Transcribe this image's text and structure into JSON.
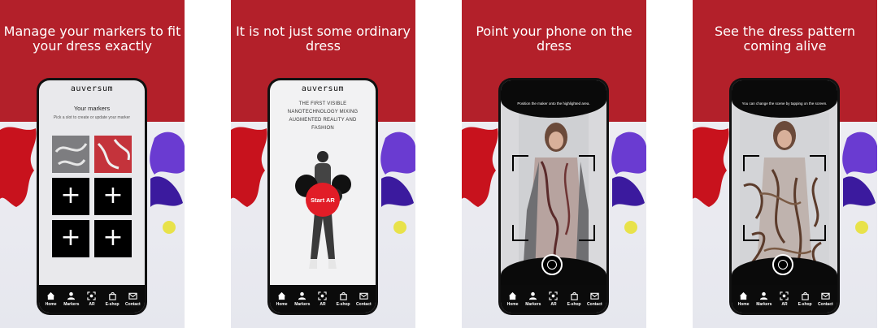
{
  "panels": [
    {
      "caption": "It is not just some ordinary dress"
    },
    {
      "caption": "Point your phone on the dress"
    },
    {
      "caption": "See the dress pattern coming alive"
    },
    {
      "caption": "Manage your markers to fit your dress exactly"
    }
  ],
  "home_screen": {
    "logo": "auversum",
    "tagline": "THE FIRST VISIBLE NANOTECHNOLOGY MIXING AUGMENTED REALITY AND FASHION",
    "start_button": "Start AR"
  },
  "ar_screen_1": {
    "instruction": "Position the maker onto the highlighted area."
  },
  "ar_screen_2": {
    "instruction": "You can change the scene by tapping on the screen."
  },
  "markers_screen": {
    "logo": "auversum",
    "title": "Your markers",
    "subtitle": "Pick a slot to create or update your marker",
    "add_symbol": "+"
  },
  "nav": {
    "home": "Home",
    "markers": "Markers",
    "ar": "AR",
    "eshop": "E-shop",
    "contact": "Contact"
  },
  "colors": {
    "brand_red": "#b3202a",
    "button_red": "#e11d27",
    "nav_bg": "#0b0b0b"
  }
}
